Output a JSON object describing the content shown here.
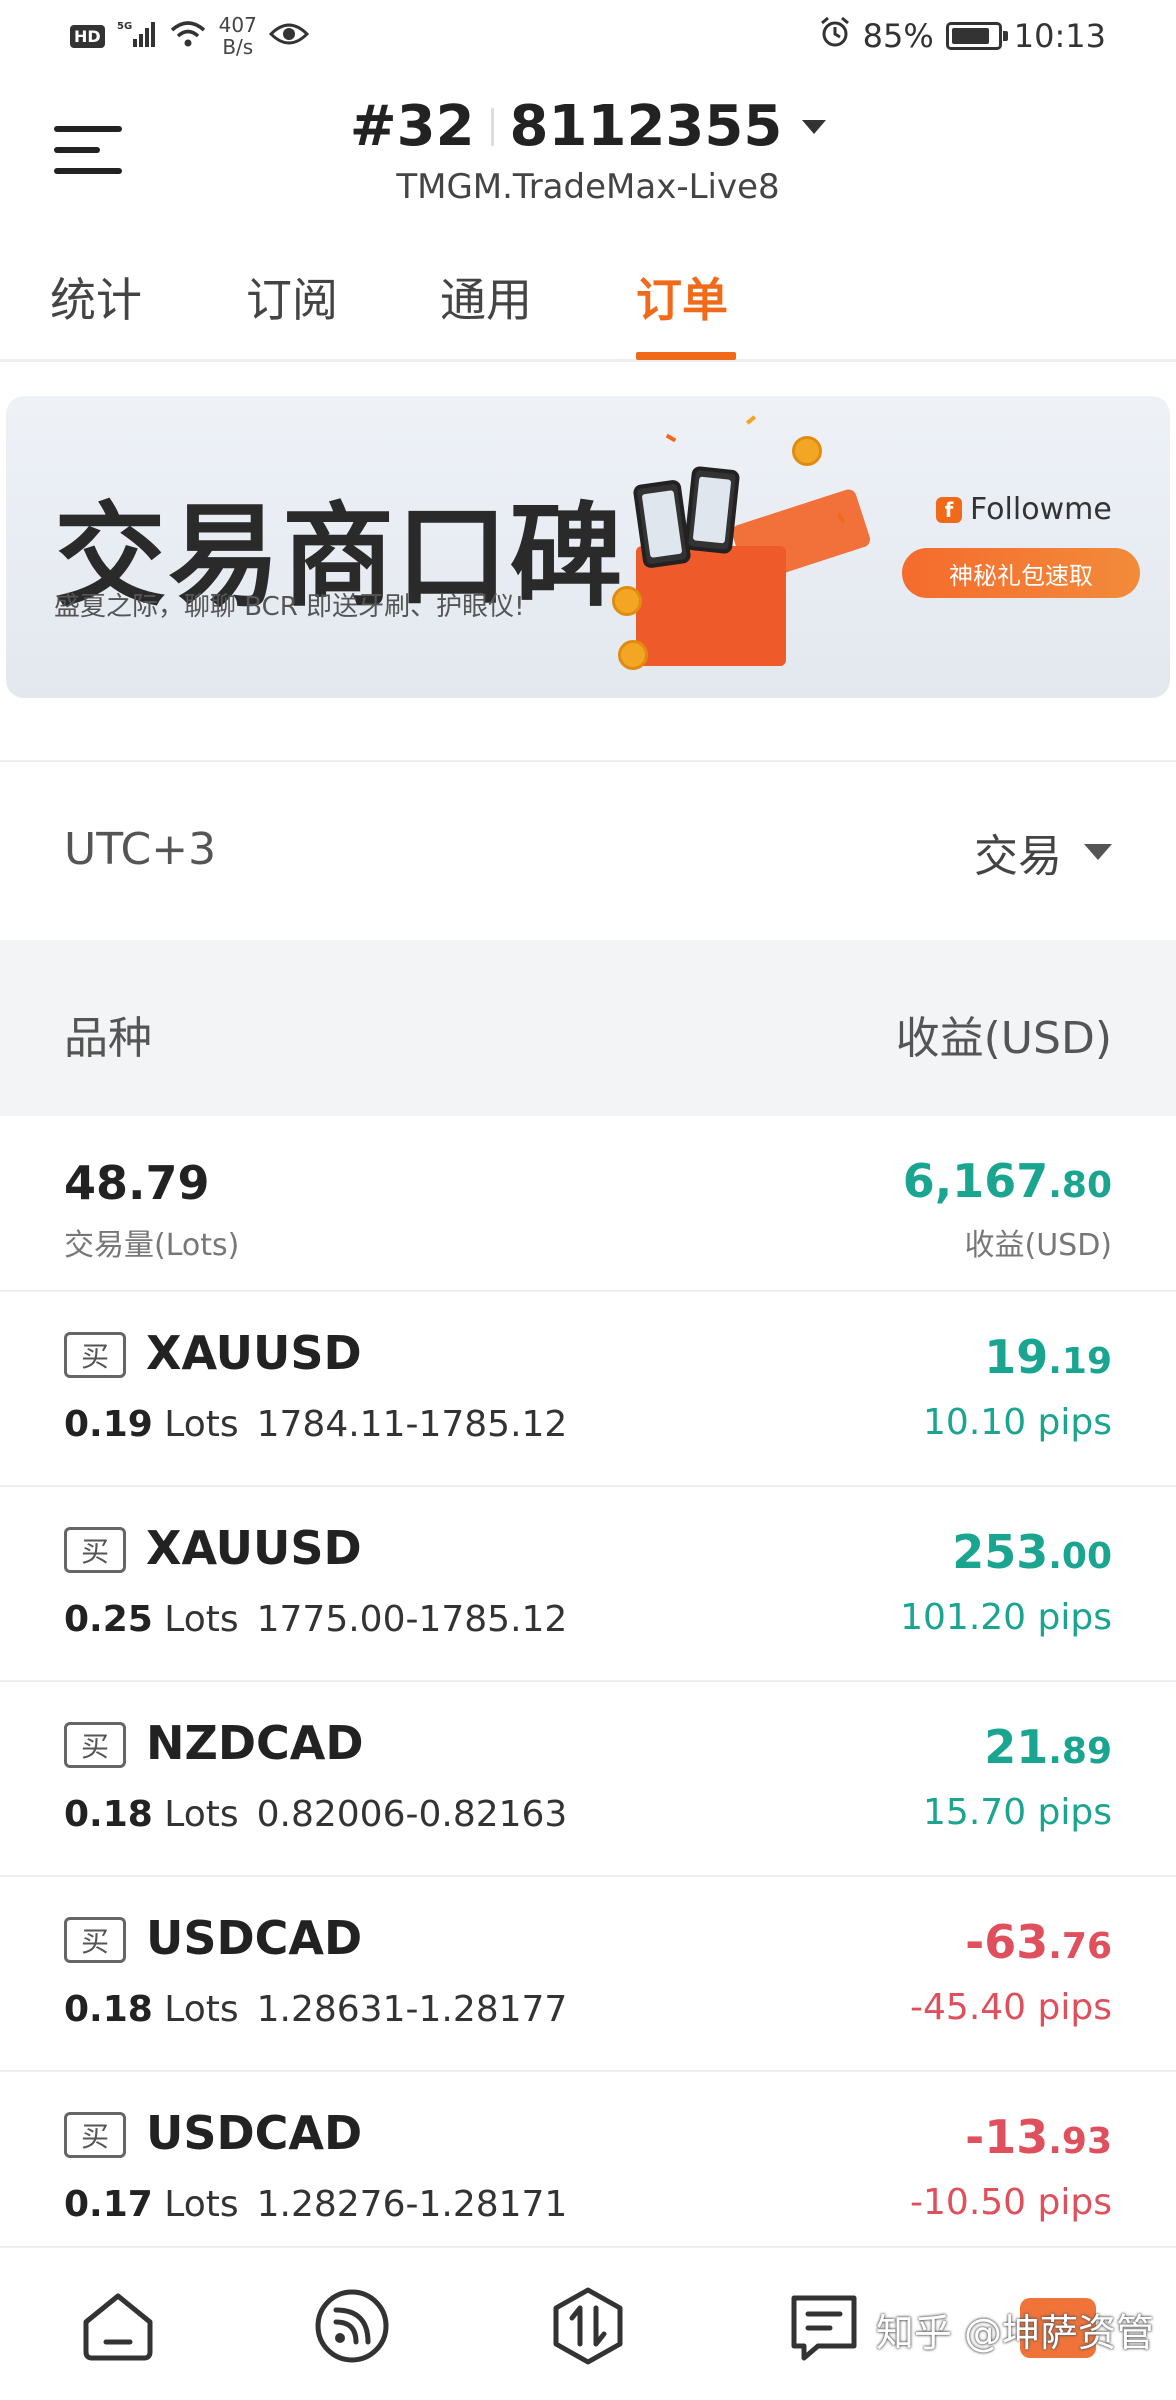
{
  "status_bar": {
    "network_speed_value": "407",
    "network_speed_unit": "B/s",
    "battery": "85%",
    "battery_level": 0.85,
    "time": "10:13"
  },
  "header": {
    "account_prefix": "#32",
    "account_number": "8112355",
    "server": "TMGM.TradeMax-Live8"
  },
  "tabs": [
    {
      "label": "统计",
      "active": false
    },
    {
      "label": "订阅",
      "active": false
    },
    {
      "label": "通用",
      "active": false
    },
    {
      "label": "订单",
      "active": true
    }
  ],
  "banner": {
    "title": "交易商口碑",
    "subtitle": "盛夏之际，聊聊 BCR 即送牙刷、护眼仪!",
    "brand": "Followme",
    "button": "神秘礼包速取"
  },
  "filter": {
    "timezone": "UTC+3",
    "type": "交易"
  },
  "table_header": {
    "symbol": "品种",
    "profit": "收益(USD)"
  },
  "summary": {
    "volume": "48.79",
    "volume_label": "交易量(Lots)",
    "profit_int": "6,167",
    "profit_dec": ".80",
    "profit_label": "收益(USD)"
  },
  "orders": [
    {
      "side": "买",
      "symbol": "XAUUSD",
      "lots": "0.19",
      "lots_unit": "Lots",
      "prices": "1784.11-1785.12",
      "profit_int": "19",
      "profit_dec": ".19",
      "pips": "10.10 pips",
      "positive": true
    },
    {
      "side": "买",
      "symbol": "XAUUSD",
      "lots": "0.25",
      "lots_unit": "Lots",
      "prices": "1775.00-1785.12",
      "profit_int": "253",
      "profit_dec": ".00",
      "pips": "101.20 pips",
      "positive": true
    },
    {
      "side": "买",
      "symbol": "NZDCAD",
      "lots": "0.18",
      "lots_unit": "Lots",
      "prices": "0.82006-0.82163",
      "profit_int": "21",
      "profit_dec": ".89",
      "pips": "15.70 pips",
      "positive": true
    },
    {
      "side": "买",
      "symbol": "USDCAD",
      "lots": "0.18",
      "lots_unit": "Lots",
      "prices": "1.28631-1.28177",
      "profit_int": "-63",
      "profit_dec": ".76",
      "pips": "-45.40 pips",
      "positive": false
    },
    {
      "side": "买",
      "symbol": "USDCAD",
      "lots": "0.17",
      "lots_unit": "Lots",
      "prices": "1.28276-1.28171",
      "profit_int": "-13",
      "profit_dec": ".93",
      "pips": "-10.50 pips",
      "positive": false
    }
  ],
  "bottom_nav": [
    {
      "icon": "home-icon"
    },
    {
      "icon": "feed-icon"
    },
    {
      "icon": "trade-icon"
    },
    {
      "icon": "message-icon"
    }
  ],
  "watermark": "知乎 @坤萨资管",
  "colors": {
    "accent": "#f06a1a",
    "positive": "#19a58f",
    "negative": "#e0505c"
  }
}
